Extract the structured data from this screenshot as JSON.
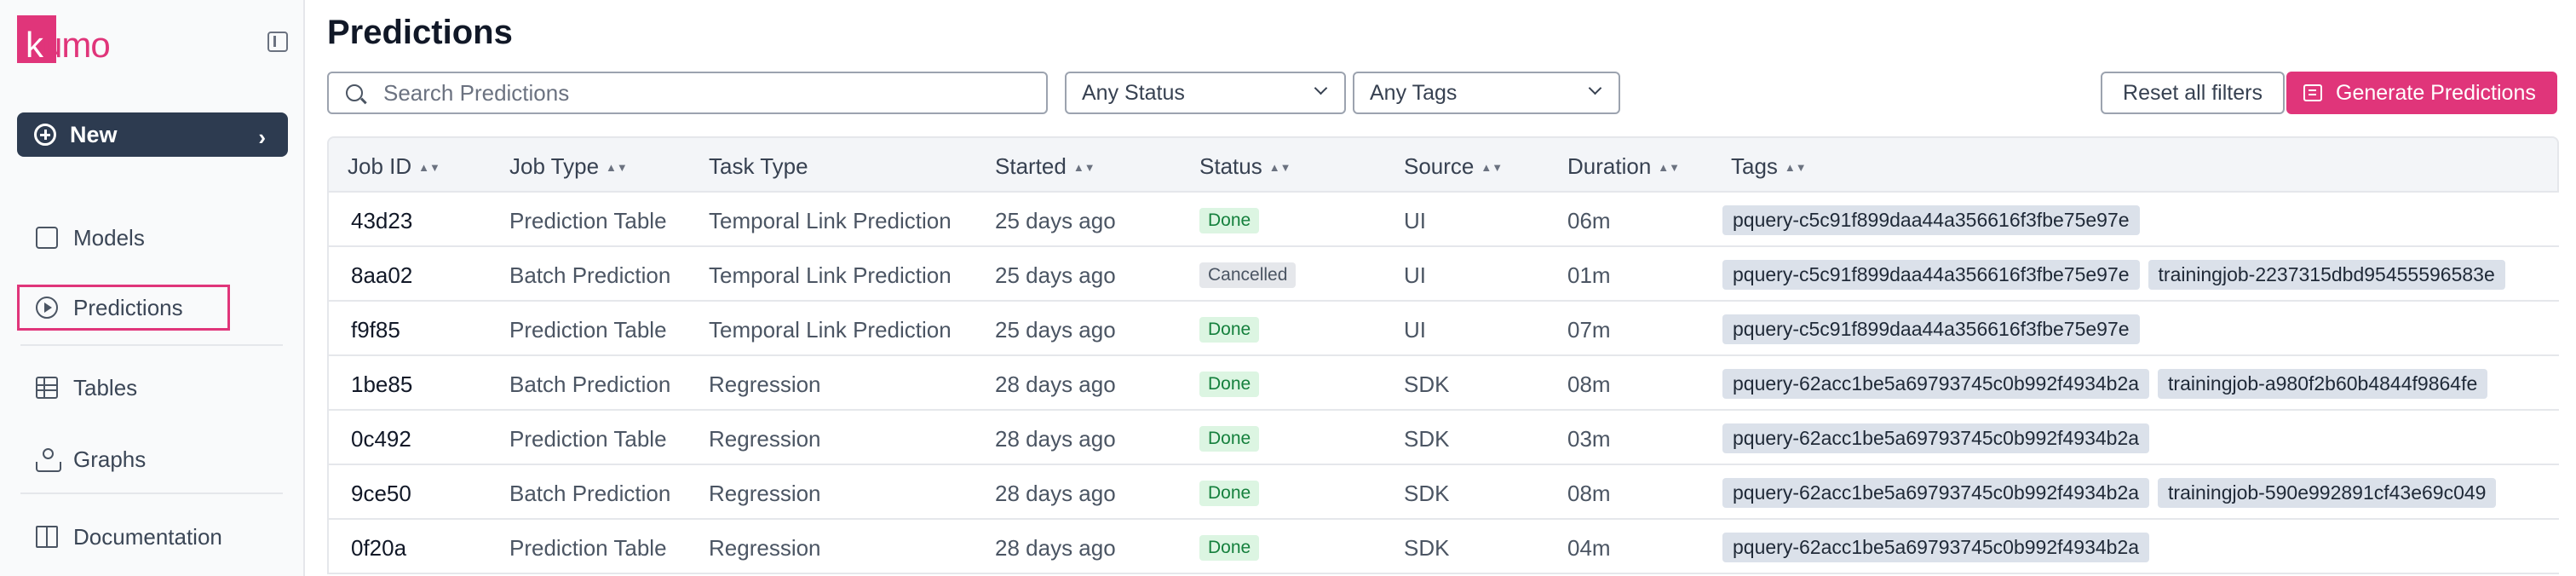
{
  "app": {
    "logo_text": "kumo"
  },
  "sidebar": {
    "new_label": "New",
    "new_chevron": "›",
    "items": [
      {
        "label": "Models",
        "icon": "cube-icon"
      },
      {
        "label": "Predictions",
        "icon": "play-circle-icon",
        "active": true
      },
      {
        "label": "Tables",
        "icon": "table-icon"
      },
      {
        "label": "Graphs",
        "icon": "graph-icon"
      },
      {
        "label": "Documentation",
        "icon": "book-icon"
      }
    ]
  },
  "header": {
    "title": "Predictions"
  },
  "filters": {
    "search_placeholder": "Search Predictions",
    "status_label": "Any Status",
    "tags_label": "Any Tags",
    "reset_label": "Reset all filters",
    "generate_label": "Generate Predictions"
  },
  "table": {
    "columns": [
      "Job ID",
      "Job Type",
      "Task Type",
      "Started",
      "Status",
      "Source",
      "Duration",
      "Tags"
    ],
    "sort_glyph": "▲▼",
    "rows": [
      {
        "job_id": "43d23",
        "job_type": "Prediction Table",
        "task_type": "Temporal Link Prediction",
        "started": "25 days ago",
        "status": "Done",
        "source": "UI",
        "duration": "06m",
        "tags": [
          "pquery-c5c91f899daa44a356616f3fbe75e97e"
        ]
      },
      {
        "job_id": "8aa02",
        "job_type": "Batch Prediction",
        "task_type": "Temporal Link Prediction",
        "started": "25 days ago",
        "status": "Cancelled",
        "source": "UI",
        "duration": "01m",
        "tags": [
          "pquery-c5c91f899daa44a356616f3fbe75e97e",
          "trainingjob-2237315dbd95455596583e"
        ]
      },
      {
        "job_id": "f9f85",
        "job_type": "Prediction Table",
        "task_type": "Temporal Link Prediction",
        "started": "25 days ago",
        "status": "Done",
        "source": "UI",
        "duration": "07m",
        "tags": [
          "pquery-c5c91f899daa44a356616f3fbe75e97e"
        ]
      },
      {
        "job_id": "1be85",
        "job_type": "Batch Prediction",
        "task_type": "Regression",
        "started": "28 days ago",
        "status": "Done",
        "source": "SDK",
        "duration": "08m",
        "tags": [
          "pquery-62acc1be5a69793745c0b992f4934b2a",
          "trainingjob-a980f2b60b4844f9864fe"
        ]
      },
      {
        "job_id": "0c492",
        "job_type": "Prediction Table",
        "task_type": "Regression",
        "started": "28 days ago",
        "status": "Done",
        "source": "SDK",
        "duration": "03m",
        "tags": [
          "pquery-62acc1be5a69793745c0b992f4934b2a"
        ]
      },
      {
        "job_id": "9ce50",
        "job_type": "Batch Prediction",
        "task_type": "Regression",
        "started": "28 days ago",
        "status": "Done",
        "source": "SDK",
        "duration": "08m",
        "tags": [
          "pquery-62acc1be5a69793745c0b992f4934b2a",
          "trainingjob-590e992891cf43e69c049"
        ]
      },
      {
        "job_id": "0f20a",
        "job_type": "Prediction Table",
        "task_type": "Regression",
        "started": "28 days ago",
        "status": "Done",
        "source": "SDK",
        "duration": "04m",
        "tags": [
          "pquery-62acc1be5a69793745c0b992f4934b2a"
        ]
      }
    ]
  },
  "colors": {
    "brand": "#e0357a",
    "nav_dark": "#2d3b50",
    "done_bg": "#dcf5e2",
    "done_text": "#15803d",
    "cancelled_bg": "#e5e7eb"
  }
}
